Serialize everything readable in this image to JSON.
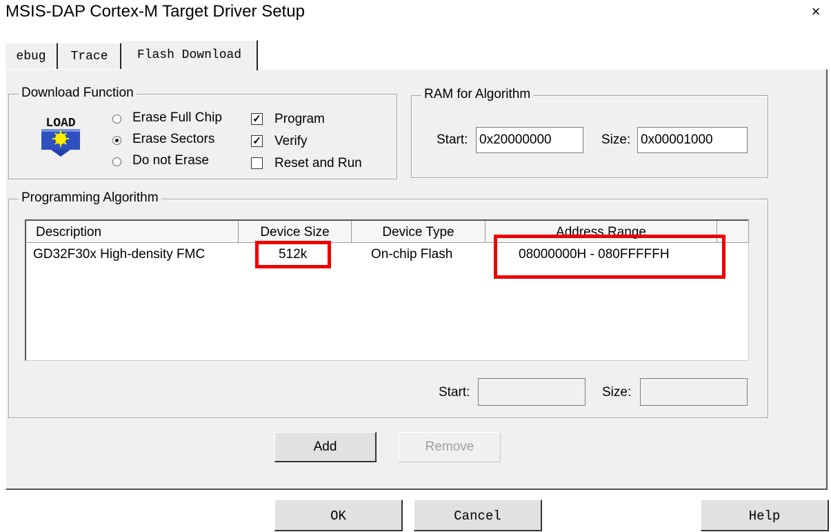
{
  "window": {
    "title": "MSIS-DAP Cortex-M Target Driver Setup",
    "close": "×"
  },
  "tabs": [
    {
      "label": "ebug"
    },
    {
      "label": "Trace"
    },
    {
      "label": "Flash Download"
    }
  ],
  "download_function": {
    "legend": "Download Function",
    "logo_text": "LOAD",
    "erase_options": [
      {
        "label": "Erase Full Chip",
        "selected": false
      },
      {
        "label": "Erase Sectors",
        "selected": true
      },
      {
        "label": "Do not Erase",
        "selected": false
      }
    ],
    "checks": [
      {
        "label": "Program",
        "checked": true
      },
      {
        "label": "Verify",
        "checked": true
      },
      {
        "label": "Reset and Run",
        "checked": false
      }
    ],
    "check_mark": "✓"
  },
  "ram": {
    "legend": "RAM for Algorithm",
    "start_label": "Start:",
    "start_value": "0x20000000",
    "size_label": "Size:",
    "size_value": "0x00001000"
  },
  "algorithm": {
    "legend": "Programming Algorithm",
    "columns": [
      "Description",
      "Device Size",
      "Device Type",
      "Address Range"
    ],
    "rows": [
      {
        "description": "GD32F30x High-density FMC",
        "size": "512k",
        "type": "On-chip Flash",
        "range": "08000000H - 080FFFFFH"
      }
    ],
    "start_label": "Start:",
    "start_value": "",
    "size_label": "Size:",
    "size_value": ""
  },
  "buttons": {
    "add": "Add",
    "remove": "Remove",
    "ok": "OK",
    "cancel": "Cancel",
    "help": "Help"
  },
  "colors": {
    "highlight": "#ee0000",
    "dialog_bg": "#f0f0f0"
  }
}
